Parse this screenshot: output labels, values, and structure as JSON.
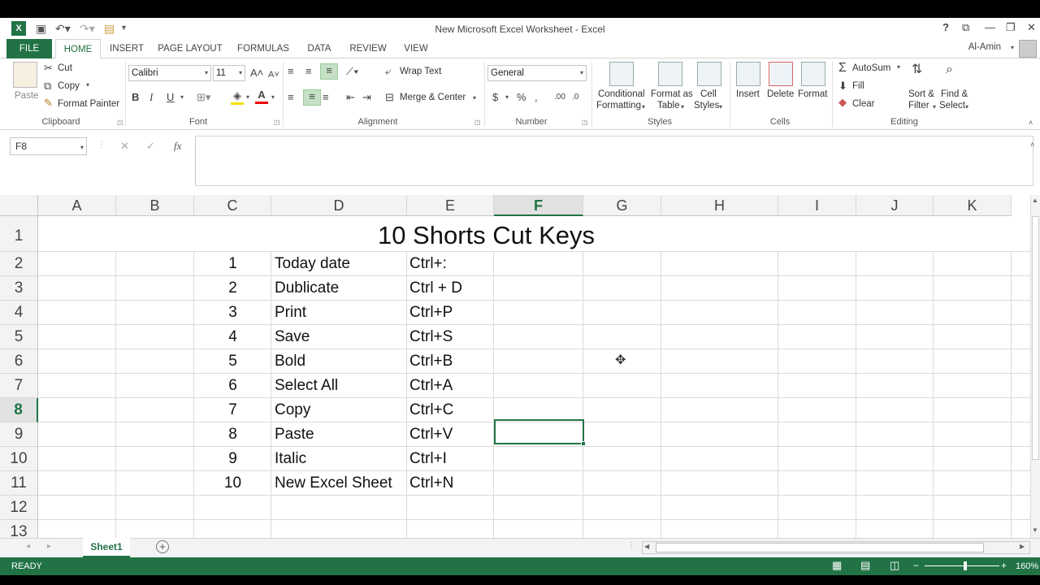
{
  "window": {
    "title": "New Microsoft Excel Worksheet - Excel",
    "help": "?",
    "user": "Al-Amin"
  },
  "tabs": [
    "FILE",
    "HOME",
    "INSERT",
    "PAGE LAYOUT",
    "FORMULAS",
    "DATA",
    "REVIEW",
    "VIEW"
  ],
  "ribbon": {
    "clipboard": {
      "paste": "Paste",
      "cut": "Cut",
      "copy": "Copy",
      "format_painter": "Format Painter",
      "label": "Clipboard"
    },
    "font": {
      "family": "Calibri",
      "size": "11",
      "bold": "B",
      "italic": "I",
      "underline": "U",
      "label": "Font"
    },
    "alignment": {
      "wrap_text": "Wrap Text",
      "merge_center": "Merge & Center",
      "label": "Alignment"
    },
    "number": {
      "format": "General",
      "currency": "$",
      "percent": "%",
      "label": "Number"
    },
    "styles": {
      "conditional": "Conditional",
      "conditional2": "Formatting",
      "format_as": "Format as",
      "format_as2": "Table",
      "cell": "Cell",
      "cell2": "Styles",
      "label": "Styles"
    },
    "cells": {
      "insert": "Insert",
      "delete": "Delete",
      "format": "Format",
      "label": "Cells"
    },
    "editing": {
      "autosum": "AutoSum",
      "fill": "Fill",
      "clear": "Clear",
      "sort": "Sort &",
      "sort2": "Filter",
      "find": "Find &",
      "find2": "Select",
      "label": "Editing"
    }
  },
  "formula_bar": {
    "name_box": "F8",
    "fx": "fx",
    "content": ""
  },
  "columns": [
    "A",
    "B",
    "C",
    "D",
    "E",
    "F",
    "G",
    "H",
    "I",
    "J",
    "K"
  ],
  "selected_column": "F",
  "rows": [
    "1",
    "2",
    "3",
    "4",
    "5",
    "6",
    "7",
    "8",
    "9",
    "10",
    "11",
    "12",
    "13"
  ],
  "selected_row": "8",
  "title": "10 Shorts Cut Keys",
  "shortcuts": [
    {
      "n": "1",
      "action": "Today date",
      "keys": "Ctrl+:"
    },
    {
      "n": "2",
      "action": "Dublicate",
      "keys": "Ctrl + D"
    },
    {
      "n": "3",
      "action": "Print",
      "keys": "Ctrl+P"
    },
    {
      "n": "4",
      "action": "Save",
      "keys": "Ctrl+S"
    },
    {
      "n": "5",
      "action": "Bold",
      "keys": "Ctrl+B"
    },
    {
      "n": "6",
      "action": "Select All",
      "keys": "Ctrl+A"
    },
    {
      "n": "7",
      "action": "Copy",
      "keys": "Ctrl+C"
    },
    {
      "n": "8",
      "action": "Paste",
      "keys": "Ctrl+V"
    },
    {
      "n": "9",
      "action": "Italic",
      "keys": "Ctrl+I"
    },
    {
      "n": "10",
      "action": "New Excel Sheet",
      "keys": "Ctrl+N"
    }
  ],
  "sheet_tab": "Sheet1",
  "status": {
    "ready": "READY",
    "zoom": "160%"
  },
  "colors": {
    "accent": "#217346"
  }
}
